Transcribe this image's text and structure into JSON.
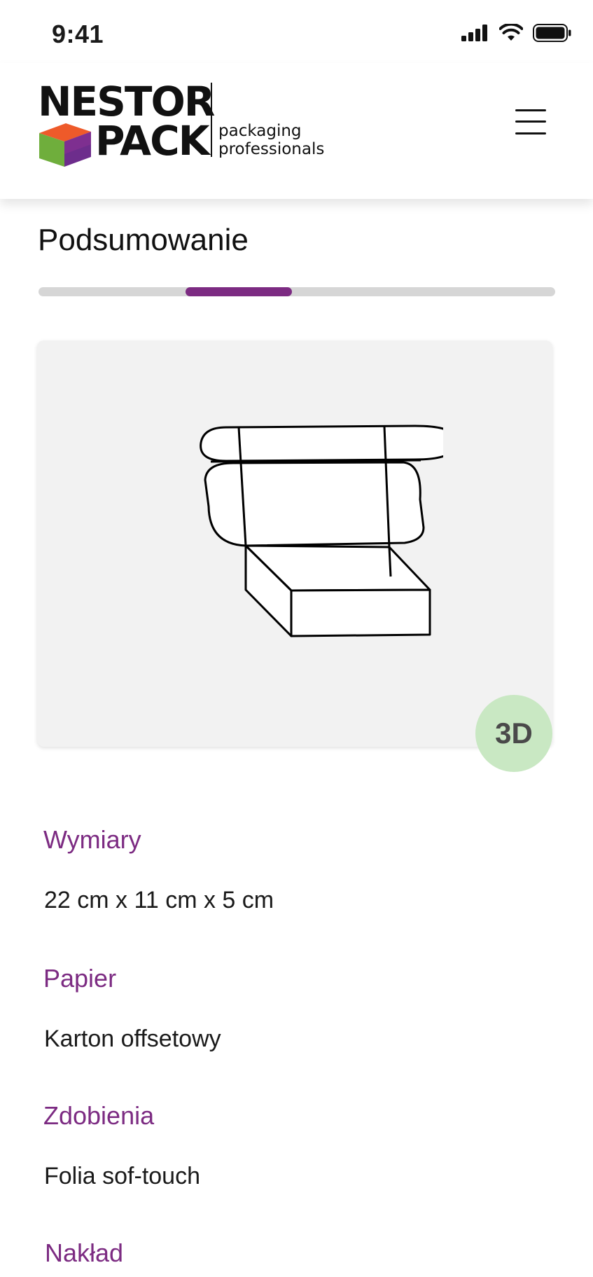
{
  "status_bar": {
    "time": "9:41"
  },
  "header": {
    "logo": {
      "word_top": "NESTOR",
      "word_bottom": "PACK",
      "tagline_line1": "packaging",
      "tagline_line2": "professionals"
    },
    "menu_icon": "hamburger-menu-icon"
  },
  "page": {
    "title": "Podsumowanie",
    "progress": {
      "steps_total": 4,
      "current_step": 2
    }
  },
  "preview": {
    "image": "mailer-box-outline",
    "view_3d_label": "3D"
  },
  "specs": [
    {
      "label": "Wymiary",
      "value": "22 cm x 11 cm x 5 cm"
    },
    {
      "label": "Papier",
      "value": "Karton offsetowy"
    },
    {
      "label": "Zdobienia",
      "value": "Folia sof-touch"
    },
    {
      "label": "Nakład"
    }
  ],
  "colors": {
    "accent": "#7c2b82",
    "progress_track": "#d6d6d6",
    "preview_bg": "#f2f2f2",
    "badge_3d_bg": "#c9e8c3"
  }
}
